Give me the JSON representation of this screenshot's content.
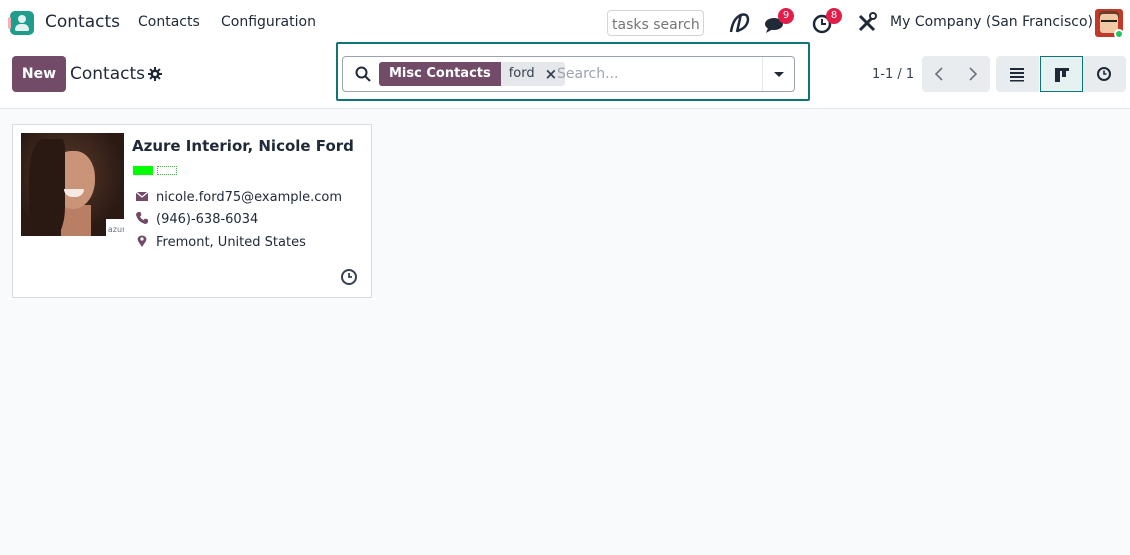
{
  "navbar": {
    "app_name": "Contacts",
    "menu": [
      "Contacts",
      "Configuration"
    ],
    "tasks_search_placeholder": "tasks search",
    "messages_badge": "9",
    "activities_badge": "8",
    "company": "My Company (San Francisco)",
    "icons": [
      "app-icon",
      "voip-icon",
      "messages-icon",
      "activities-icon",
      "debug-icon",
      "user-avatar"
    ]
  },
  "control": {
    "new_label": "New",
    "title": "Contacts",
    "search": {
      "facet_label": "Misc Contacts",
      "facet_value": "ford",
      "placeholder": "Search..."
    },
    "pager": "1-1 / 1",
    "views": [
      "list",
      "kanban",
      "activity"
    ],
    "active_view": "kanban"
  },
  "card": {
    "name": "Azure Interior, Nicole Ford",
    "company_logo_text": "azure",
    "email": "nicole.ford75@example.com",
    "phone": "(946)-638-6034",
    "address": "Fremont, United States",
    "tag_colors": [
      "#00ff00",
      "#ffffff"
    ]
  },
  "colors": {
    "primary": "#714b67",
    "focus": "#0f7574",
    "badge": "#e11d48",
    "online": "#22c55e"
  }
}
